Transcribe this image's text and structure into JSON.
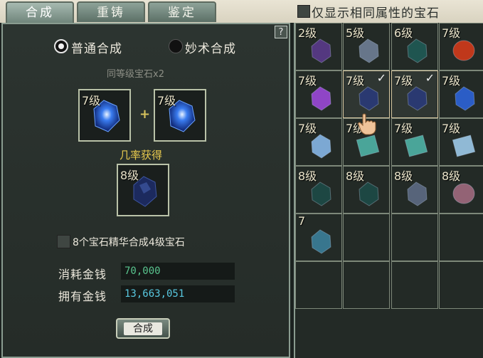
{
  "tabs": [
    {
      "label": "合成",
      "active": true
    },
    {
      "label": "重铸",
      "active": false
    },
    {
      "label": "鉴定",
      "active": false
    }
  ],
  "filter": {
    "label": "仅显示相同属性的宝石",
    "checked": false
  },
  "help_label": "?",
  "mode": {
    "normal_label": "普通合成",
    "miao_label": "妙术合成",
    "selected": "normal"
  },
  "hint": "同等级宝石x2",
  "input_slots": [
    {
      "level": "7级",
      "gem": "blue-crystal"
    },
    {
      "level": "7级",
      "gem": "blue-crystal"
    }
  ],
  "plus": "+",
  "prob_label": "几率获得",
  "output_slot": {
    "level": "8级",
    "gem": "dark-blue-gem"
  },
  "essence": {
    "label": "8个宝石精华合成4级宝石",
    "checked": false
  },
  "money": {
    "cost_label": "消耗金钱",
    "cost_value": "70,000",
    "own_label": "拥有金钱",
    "own_value": "13,663,051"
  },
  "synth_button": "合成",
  "inventory": [
    [
      {
        "level": "2级",
        "gem": "purple-diamond",
        "color": "#5a3a8a"
      },
      {
        "level": "5级",
        "gem": "gray-blue-stone",
        "color": "#6f7f95"
      },
      {
        "level": "6级",
        "gem": "teal-stone",
        "color": "#1f5a55"
      },
      {
        "level": "7级",
        "gem": "red-orb",
        "color": "#d23a1a"
      }
    ],
    [
      {
        "level": "7级",
        "gem": "violet-crystal",
        "color": "#9b49d8"
      },
      {
        "level": "7级",
        "gem": "dark-blue-gem",
        "color": "#2a3a78",
        "checked": true
      },
      {
        "level": "7级",
        "gem": "dark-blue-gem",
        "color": "#2a3a78",
        "checked": true
      },
      {
        "level": "7级",
        "gem": "blue-crystal",
        "color": "#2c63d8"
      }
    ],
    [
      {
        "level": "7级",
        "gem": "ice-crystal",
        "color": "#86b6e6"
      },
      {
        "level": "7级",
        "gem": "aqua-block",
        "color": "#4fb3a6"
      },
      {
        "level": "7级",
        "gem": "aqua-block",
        "color": "#4fb3a6"
      },
      {
        "level": "7级",
        "gem": "ice-cube",
        "color": "#9cc9e8"
      }
    ],
    [
      {
        "level": "8级",
        "gem": "teal-stone",
        "color": "#1d4b47"
      },
      {
        "level": "8级",
        "gem": "teal-stone",
        "color": "#1d4b47"
      },
      {
        "level": "8级",
        "gem": "gray-blue-stone",
        "color": "#5d6b84"
      },
      {
        "level": "8级",
        "gem": "pink-heart",
        "color": "#a06a7e"
      }
    ],
    [
      {
        "level": "7",
        "gem": "blue-essence-cluster",
        "color": "#3b7f9a"
      },
      null,
      null,
      null
    ],
    [
      null,
      null,
      null,
      null
    ]
  ]
}
